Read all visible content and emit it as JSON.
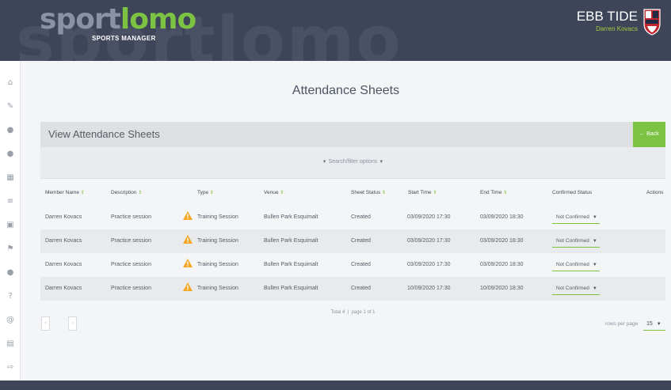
{
  "header": {
    "watermark": "sportlomo",
    "logo_part1": "sport",
    "logo_part2": "lomo",
    "logo_sub": "SPORTS MANAGER",
    "club_name": "EBB TIDE",
    "user_name": "Darren Kovacs"
  },
  "sidebar": {
    "icons": [
      "home-icon",
      "edit-icon",
      "user-icon",
      "users-icon",
      "calendar-icon",
      "list-icon",
      "clipboard-icon",
      "flag-icon",
      "person-icon",
      "help-icon",
      "at-icon",
      "document-icon",
      "logout-icon"
    ]
  },
  "page": {
    "title": "Attendance Sheets"
  },
  "panel": {
    "title": "View Attendance Sheets",
    "back_label": "← Back",
    "search_label": "Search/filter options"
  },
  "table": {
    "columns": [
      "Member Name",
      "Description",
      "Type",
      "Venue",
      "Sheet Status",
      "Start Time",
      "End Time",
      "Confirmed Status",
      "Actions"
    ],
    "rows": [
      {
        "member": "Darren Kovacs",
        "description": "Practice session",
        "type": "Training Session",
        "venue": "Bullen Park Esquimalt",
        "status": "Created",
        "start": "03/09/2020 17:30",
        "end": "03/09/2020 18:30",
        "confirmed": "Not Confirmed"
      },
      {
        "member": "Darren Kovacs",
        "description": "Practice session",
        "type": "Training Session",
        "venue": "Bullen Park Esquimalt",
        "status": "Created",
        "start": "03/09/2020 17:30",
        "end": "03/09/2020 18:30",
        "confirmed": "Not Confirmed"
      },
      {
        "member": "Darren Kovacs",
        "description": "Practice session",
        "type": "Training Session",
        "venue": "Bullen Park Esquimalt",
        "status": "Created",
        "start": "03/09/2020 17:30",
        "end": "03/09/2020 18:30",
        "confirmed": "Not Confirmed"
      },
      {
        "member": "Darren Kovacs",
        "description": "Practice session",
        "type": "Training Session",
        "venue": "Bullen Park Esquimalt",
        "status": "Created",
        "start": "10/09/2020 17:30",
        "end": "10/09/2020 18:30",
        "confirmed": "Not Confirmed"
      }
    ]
  },
  "pagination": {
    "total": "Total 4",
    "page": "page 1 of 1",
    "prev": "‹",
    "next": "›",
    "rows_per_page_label": "rows per page",
    "rows_per_page": "15"
  },
  "colors": {
    "header_bg": "#3e4558",
    "accent": "#7cc243",
    "warning": "#f5a623"
  }
}
